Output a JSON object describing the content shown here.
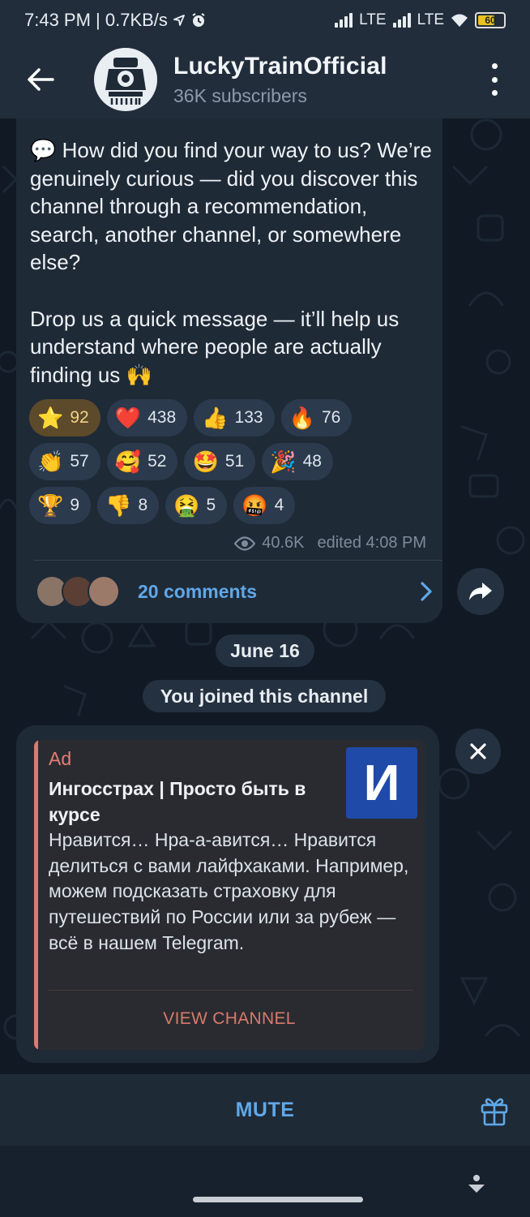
{
  "status": {
    "time": "7:43 PM | 0.7KB/s",
    "network1": "LTE",
    "network2": "LTE",
    "battery": "60"
  },
  "header": {
    "channel_name": "LuckyTrainOfficial",
    "subscribers": "36K subscribers"
  },
  "post": {
    "text": "💬 How did you find your way to us? We’re genuinely curious — did you discover this channel through a recommendation, search, another channel, or somewhere else?\n\nDrop us a quick message — it’ll help us understand where people are actually finding us 🙌",
    "reactions": [
      {
        "emoji": "⭐",
        "count": "92",
        "name": "star"
      },
      {
        "emoji": "❤️",
        "count": "438",
        "name": "heart"
      },
      {
        "emoji": "👍",
        "count": "133",
        "name": "thumbs-up"
      },
      {
        "emoji": "🔥",
        "count": "76",
        "name": "fire"
      },
      {
        "emoji": "👏",
        "count": "57",
        "name": "clap"
      },
      {
        "emoji": "🥰",
        "count": "52",
        "name": "smiling-hearts"
      },
      {
        "emoji": "🤩",
        "count": "51",
        "name": "star-struck"
      },
      {
        "emoji": "🎉",
        "count": "48",
        "name": "party"
      },
      {
        "emoji": "🏆",
        "count": "9",
        "name": "trophy"
      },
      {
        "emoji": "👎",
        "count": "8",
        "name": "thumbs-down"
      },
      {
        "emoji": "🤮",
        "count": "5",
        "name": "vomit"
      },
      {
        "emoji": "🤬",
        "count": "4",
        "name": "cursing"
      }
    ],
    "views": "40.6K",
    "edited": "edited 4:08 PM",
    "comments": "20 comments"
  },
  "service": {
    "date": "June 16",
    "joined": "You joined this channel"
  },
  "ad": {
    "label": "Ad",
    "title": "Ингосстрах | Просто быть в курсе",
    "text": "Нравится… Нра-а-авится… Нравится делиться с вами лайфхаками. Например, можем подсказать страховку для путешествий по России или за рубеж — всё в нашем Telegram.",
    "logo_letter": "И",
    "button": "VIEW CHANNEL"
  },
  "bottom": {
    "mute": "MUTE"
  },
  "colors": {
    "accent": "#5fa8e8",
    "ad_accent": "#d97b72",
    "bubble": "#1f2a37",
    "header": "#212d3b"
  }
}
